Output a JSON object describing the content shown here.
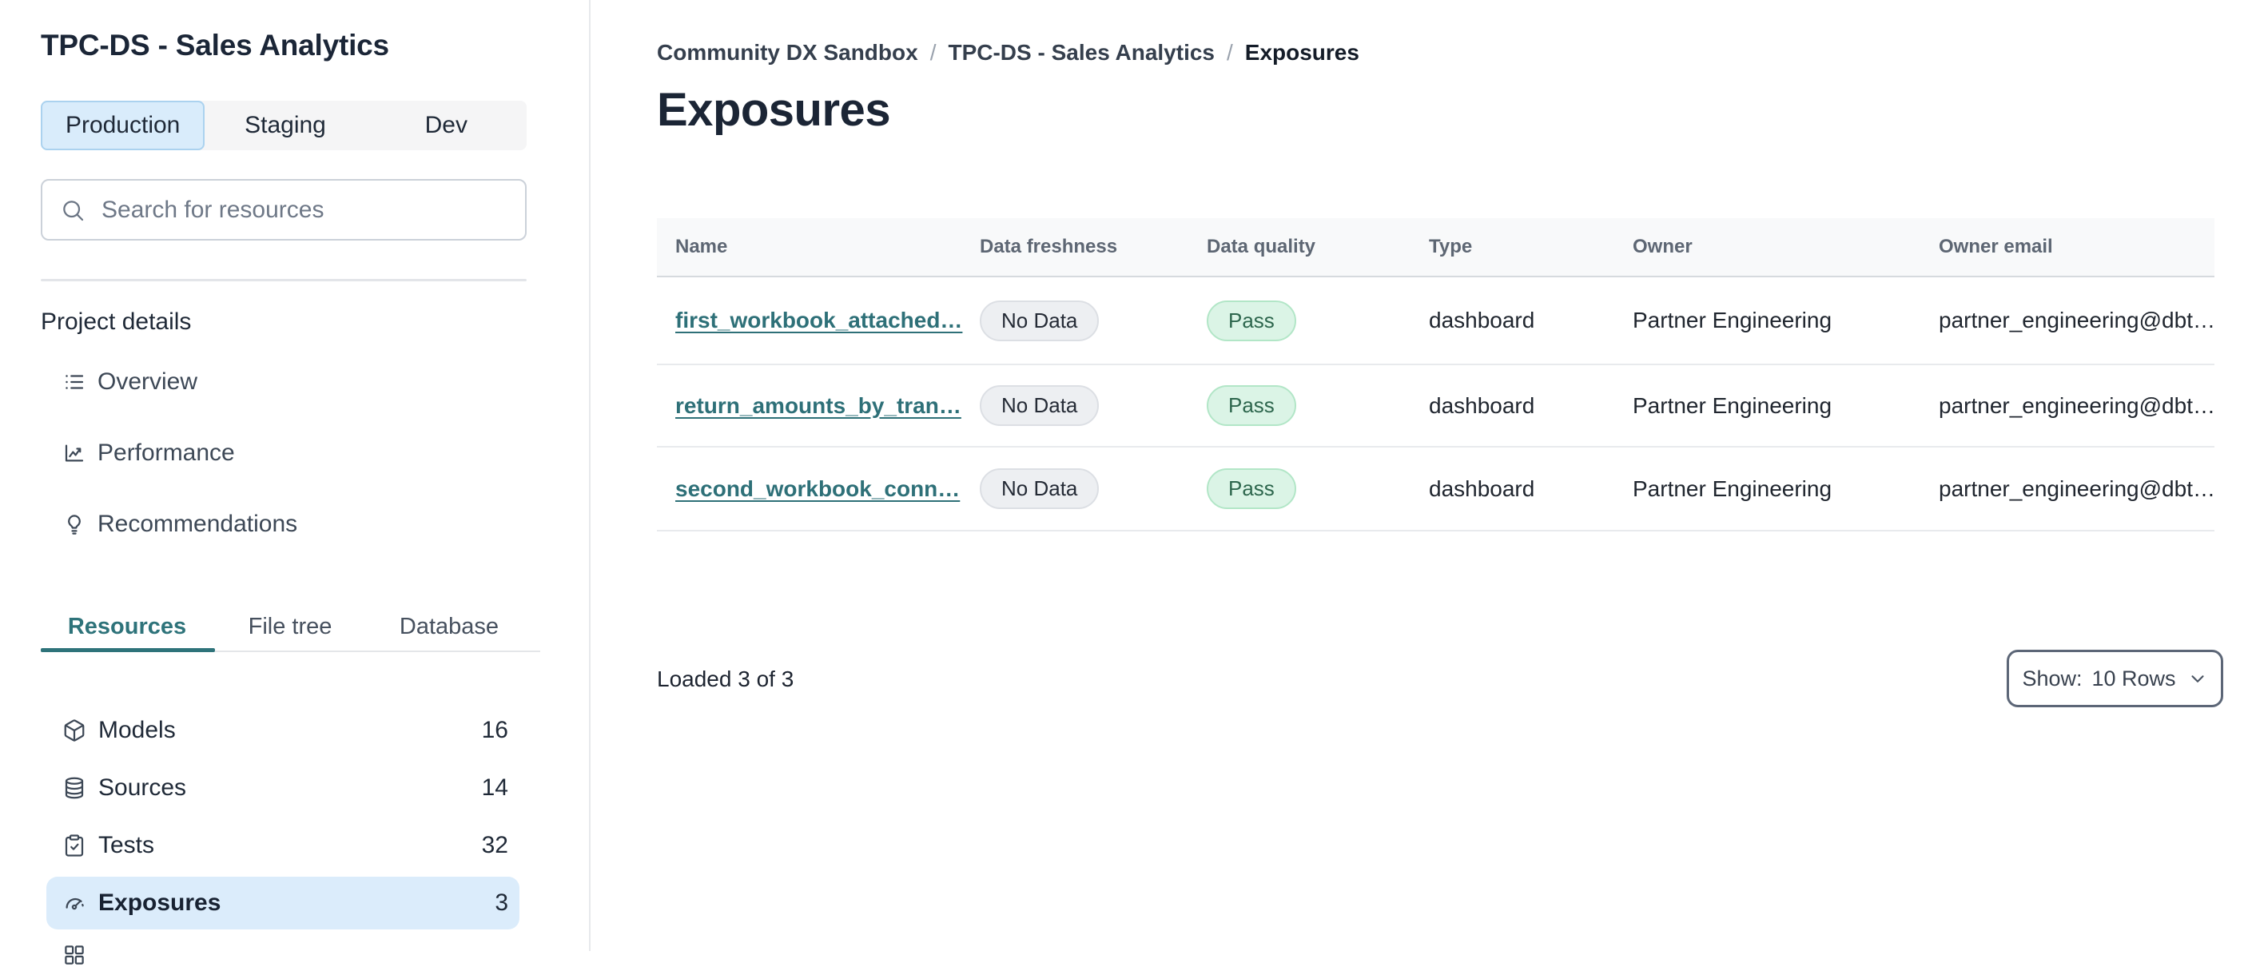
{
  "app": {
    "project_title": "TPC-DS - Sales Analytics"
  },
  "sidebar": {
    "env_tabs": [
      {
        "label": "Production",
        "selected": true
      },
      {
        "label": "Staging",
        "selected": false
      },
      {
        "label": "Dev",
        "selected": false
      }
    ],
    "search": {
      "placeholder": "Search for resources",
      "icon": "search-icon"
    },
    "section_label": "Project details",
    "nav": [
      {
        "label": "Overview",
        "icon": "list-icon"
      },
      {
        "label": "Performance",
        "icon": "line-chart-icon"
      },
      {
        "label": "Recommendations",
        "icon": "lightbulb-icon"
      }
    ],
    "resource_tabs": [
      {
        "label": "Resources",
        "selected": true
      },
      {
        "label": "File tree",
        "selected": false
      },
      {
        "label": "Database",
        "selected": false
      }
    ],
    "resources": [
      {
        "label": "Models",
        "count": "16",
        "icon": "cube-icon",
        "selected": false
      },
      {
        "label": "Sources",
        "count": "14",
        "icon": "database-icon",
        "selected": false
      },
      {
        "label": "Tests",
        "count": "32",
        "icon": "clipboard-check-icon",
        "selected": false
      },
      {
        "label": "Exposures",
        "count": "3",
        "icon": "gauge-icon",
        "selected": true
      }
    ],
    "partial_item_icon": "grid-icon"
  },
  "main": {
    "breadcrumb": {
      "separator": "/",
      "items": [
        "Community DX Sandbox",
        "TPC-DS - Sales Analytics",
        "Exposures"
      ]
    },
    "page_title": "Exposures",
    "table": {
      "columns": [
        "Name",
        "Data freshness",
        "Data quality",
        "Type",
        "Owner",
        "Owner email"
      ],
      "rows": [
        {
          "name": "first_workbook_attached…",
          "freshness": "No Data",
          "quality": "Pass",
          "type": "dashboard",
          "owner": "Partner Engineering",
          "owner_email": "partner_engineering@dbt…"
        },
        {
          "name": "return_amounts_by_tran…",
          "freshness": "No Data",
          "quality": "Pass",
          "type": "dashboard",
          "owner": "Partner Engineering",
          "owner_email": "partner_engineering@dbt…"
        },
        {
          "name": "second_workbook_conn…",
          "freshness": "No Data",
          "quality": "Pass",
          "type": "dashboard",
          "owner": "Partner Engineering",
          "owner_email": "partner_engineering@dbt…"
        }
      ]
    },
    "footer": {
      "loaded_text": "Loaded 3 of 3",
      "show_label": "Show:",
      "show_value": "10 Rows",
      "chevron": "chevron-down-icon"
    }
  },
  "colors": {
    "accent_teal": "#2e737a",
    "selected_blue_bg": "#dbecfb",
    "env_tab_selected_bg": "#d9ecfb",
    "env_tab_selected_border": "#abd2ef",
    "pill_gray_bg": "#edeff2",
    "pill_green_bg": "#dbf4e6",
    "pill_green_border": "#b2e6c7",
    "pill_green_text": "#2d664d",
    "header_bg": "#f8f9fa",
    "text_dark": "#1b2637"
  }
}
